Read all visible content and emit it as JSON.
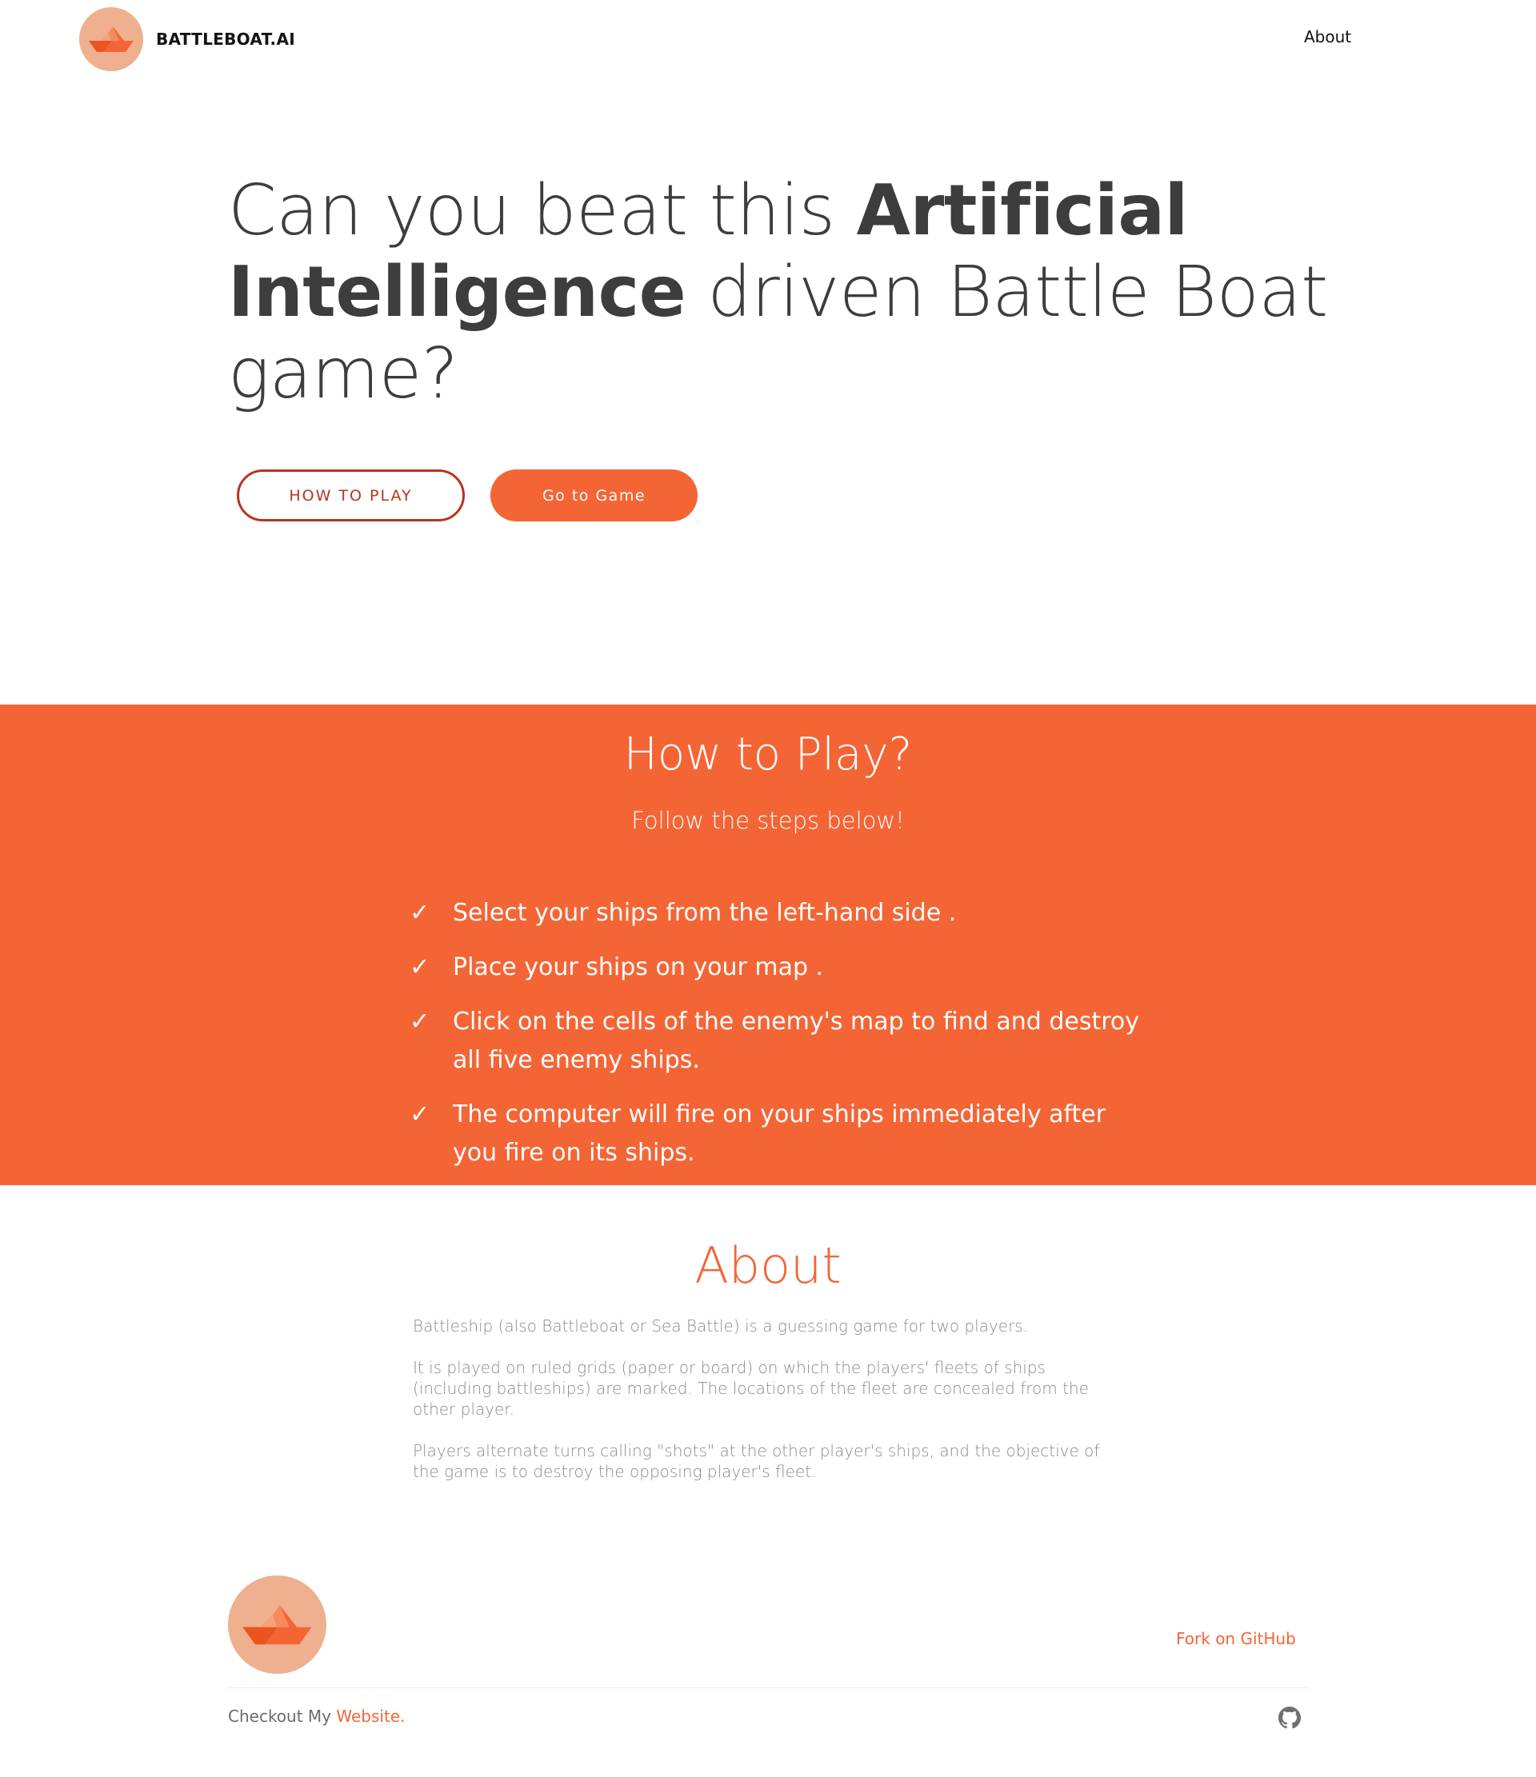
{
  "header": {
    "brand_name": "BATTLEBOAT.AI",
    "logo_icon": "paper-boat-icon",
    "nav": {
      "about_label": "About"
    }
  },
  "hero": {
    "title_part1": "Can you beat this ",
    "title_bold": "Artificial Intelligence",
    "title_part2": " driven Battle Boat game?",
    "how_to_play_button": "HOW TO PLAY",
    "go_to_game_button": "Go to Game"
  },
  "how_to_play": {
    "title": "How to Play?",
    "subtitle": "Follow the steps below!",
    "check_glyph": "✓",
    "steps": [
      "Select your ships from the left-hand side .",
      "Place your ships on your map .",
      "Click on the cells of the enemy's map to find and destroy all five enemy ships.",
      "The computer will fire on your ships immediately after you fire on its ships."
    ]
  },
  "about": {
    "title": "About",
    "paragraphs": [
      "Battleship (also Battleboat or Sea Battle) is a guessing game for two players.",
      "It is played on ruled grids (paper or board) on which the players' fleets of ships (including battleships) are marked. The locations of the fleet are concealed from the other player.",
      "Players alternate turns calling \"shots\" at the other player's ships, and the objective of the game is to destroy the opposing player's fleet."
    ]
  },
  "footer": {
    "fork_link": "Fork on GitHub",
    "note_prefix": "Checkout My ",
    "note_link": "Website.",
    "github_icon": "github-icon"
  },
  "colors": {
    "accent": "#f46536",
    "outline_button": "#b8351c",
    "logo_bg": "#eeb08f",
    "heading_text": "#3d3d3d",
    "body_text": "#8a8a8a"
  }
}
